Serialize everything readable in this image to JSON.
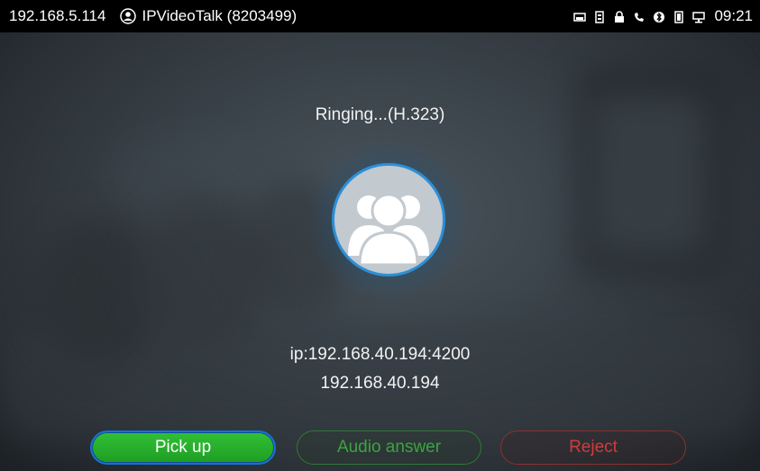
{
  "statusbar": {
    "local_ip": "192.168.5.114",
    "account": "IPVideoTalk (8203499)",
    "time": "09:21",
    "icons": [
      "screen-icon",
      "sim-icon",
      "lock-icon",
      "phone-icon",
      "bluetooth-icon",
      "storage-icon",
      "network-icon"
    ]
  },
  "call": {
    "status": "Ringing...(H.323)",
    "remote_ip": "ip:192.168.40.194:4200",
    "remote_name": "192.168.40.194"
  },
  "actions": {
    "pickup": "Pick up",
    "audio_answer": "Audio answer",
    "reject": "Reject"
  },
  "colors": {
    "pickup": "#22a827",
    "audio_answer": "#3aa53f",
    "reject": "#d03c3c",
    "avatar_ring": "#2c8fd8"
  }
}
